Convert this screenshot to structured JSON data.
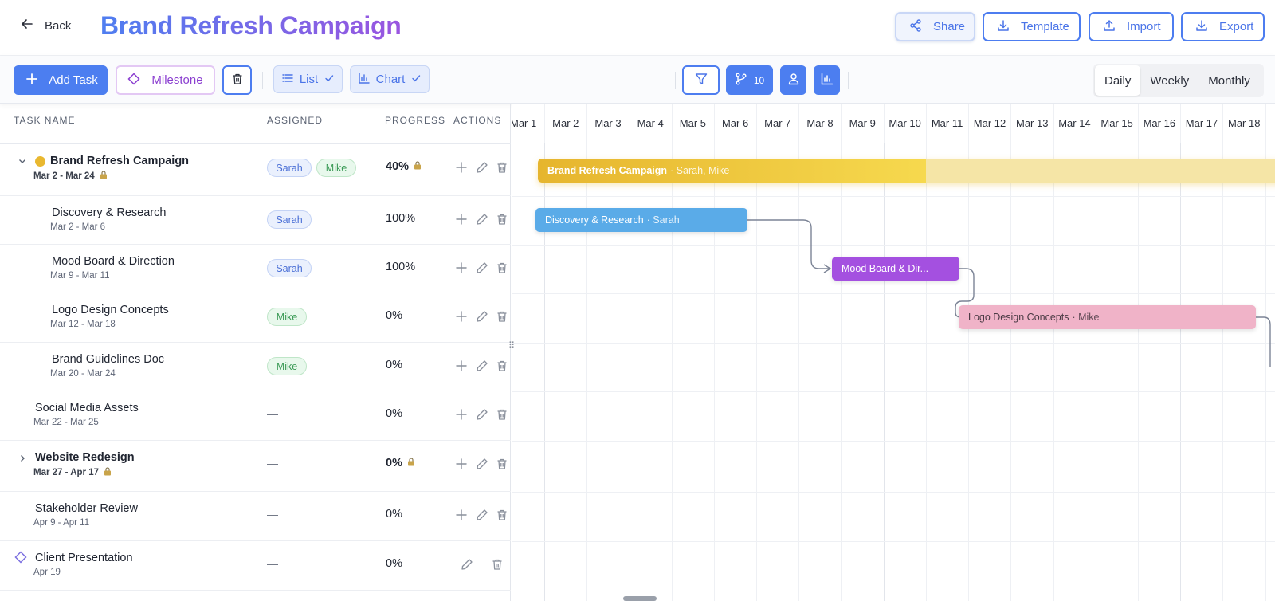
{
  "header": {
    "back_label": "Back",
    "title": "Brand Refresh Campaign",
    "share_label": "Share",
    "template_label": "Template",
    "import_label": "Import",
    "export_label": "Export"
  },
  "toolbar": {
    "add_task_label": "Add Task",
    "milestone_label": "Milestone",
    "list_label": "List",
    "chart_label": "Chart",
    "dependency_count": "10",
    "views": [
      "Daily",
      "Weekly",
      "Monthly"
    ],
    "active_view": "Daily"
  },
  "table": {
    "columns": [
      "TASK NAME",
      "ASSIGNED",
      "PROGRESS",
      "ACTIONS"
    ],
    "rows": [
      {
        "name": "Brand Refresh Campaign",
        "dates": "Mar 2 - Mar 24",
        "assignees": [
          "Sarah",
          "Mike"
        ],
        "progress": "40%"
      },
      {
        "name": "Discovery & Research",
        "dates": "Mar 2 - Mar 6",
        "assignees": [
          "Sarah"
        ],
        "progress": "100%"
      },
      {
        "name": "Mood Board & Direction",
        "dates": "Mar 9 - Mar 11",
        "assignees": [
          "Sarah"
        ],
        "progress": "100%"
      },
      {
        "name": "Logo Design Concepts",
        "dates": "Mar 12 - Mar 18",
        "assignees": [
          "Mike"
        ],
        "progress": "0%"
      },
      {
        "name": "Brand Guidelines Doc",
        "dates": "Mar 20 - Mar 24",
        "assignees": [
          "Mike"
        ],
        "progress": "0%"
      },
      {
        "name": "Social Media Assets",
        "dates": "Mar 22 - Mar 25",
        "assignees": "—",
        "progress": "0%"
      },
      {
        "name": "Website Redesign",
        "dates": "Mar 27 - Apr 17",
        "assignees": "—",
        "progress": "0%"
      },
      {
        "name": "Stakeholder Review",
        "dates": "Apr 9 - Apr 11",
        "assignees": "—",
        "progress": "0%"
      },
      {
        "name": "Client Presentation",
        "dates": "Apr 19",
        "assignees": "—",
        "progress": "0%"
      }
    ]
  },
  "gantt": {
    "days": [
      "Mar 1",
      "Mar 2",
      "Mar 3",
      "Mar 4",
      "Mar 5",
      "Mar 6",
      "Mar 7",
      "Mar 8",
      "Mar 9",
      "Mar 10",
      "Mar 11",
      "Mar 12",
      "Mar 13",
      "Mar 14",
      "Mar 15",
      "Mar 16",
      "Mar 17",
      "Mar 18",
      "Mar"
    ],
    "bars": [
      {
        "label": "Brand Refresh Campaign",
        "sub": "· Sarah, Mike",
        "color": "#edc134",
        "progress": 0.4
      },
      {
        "label": "Discovery & Research",
        "sub": "· Sarah",
        "color": "#5aabe8"
      },
      {
        "label": "Mood Board & Dir...",
        "sub": "",
        "color": "#a450e0"
      },
      {
        "label": "Logo Design Concepts",
        "sub": "· Mike",
        "color": "#f0b3c8"
      }
    ]
  },
  "colors": {
    "accent": "#4c7ef0",
    "milestone": "#8b3fd0",
    "summary_bar": "#edc134"
  }
}
